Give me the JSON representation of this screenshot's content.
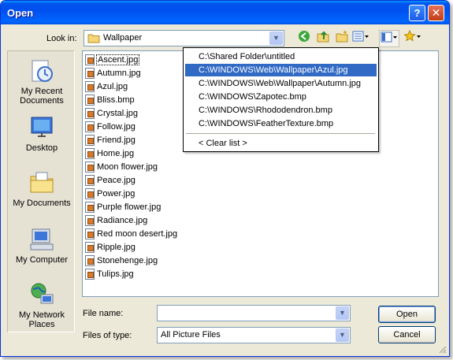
{
  "window": {
    "title": "Open"
  },
  "lookin": {
    "label": "Look in:",
    "value": "Wallpaper"
  },
  "places": [
    {
      "label": "My Recent Documents",
      "icon": "recent-documents-icon"
    },
    {
      "label": "Desktop",
      "icon": "desktop-icon"
    },
    {
      "label": "My Documents",
      "icon": "my-documents-icon"
    },
    {
      "label": "My Computer",
      "icon": "my-computer-icon"
    },
    {
      "label": "My Network Places",
      "icon": "network-places-icon"
    }
  ],
  "files": [
    "Ascent.jpg",
    "Autumn.jpg",
    "Azul.jpg",
    "Bliss.bmp",
    "Crystal.jpg",
    "Follow.jpg",
    "Friend.jpg",
    "Home.jpg",
    "Moon flower.jpg",
    "Peace.jpg",
    "Power.jpg",
    "Purple flower.jpg",
    "Radiance.jpg",
    "Red moon desert.jpg",
    "Ripple.jpg",
    "Stonehenge.jpg",
    "Tulips.jpg"
  ],
  "history": {
    "items": [
      "C:\\Shared Folder\\untitled",
      "C:\\WINDOWS\\Web\\Wallpaper\\Azul.jpg",
      "C:\\WINDOWS\\Web\\Wallpaper\\Autumn.jpg",
      "C:\\WINDOWS\\Zapotec.bmp",
      "C:\\WINDOWS\\Rhododendron.bmp",
      "C:\\WINDOWS\\FeatherTexture.bmp"
    ],
    "highlighted_index": 1,
    "clear_label": "< Clear list >"
  },
  "filename": {
    "label": "File name:",
    "value": ""
  },
  "filetype": {
    "label": "Files of type:",
    "value": "All Picture Files"
  },
  "buttons": {
    "open": "Open",
    "cancel": "Cancel"
  },
  "colors": {
    "titlebar": "#0054e3",
    "selection": "#316ac5",
    "window_bg": "#ece9d8"
  }
}
